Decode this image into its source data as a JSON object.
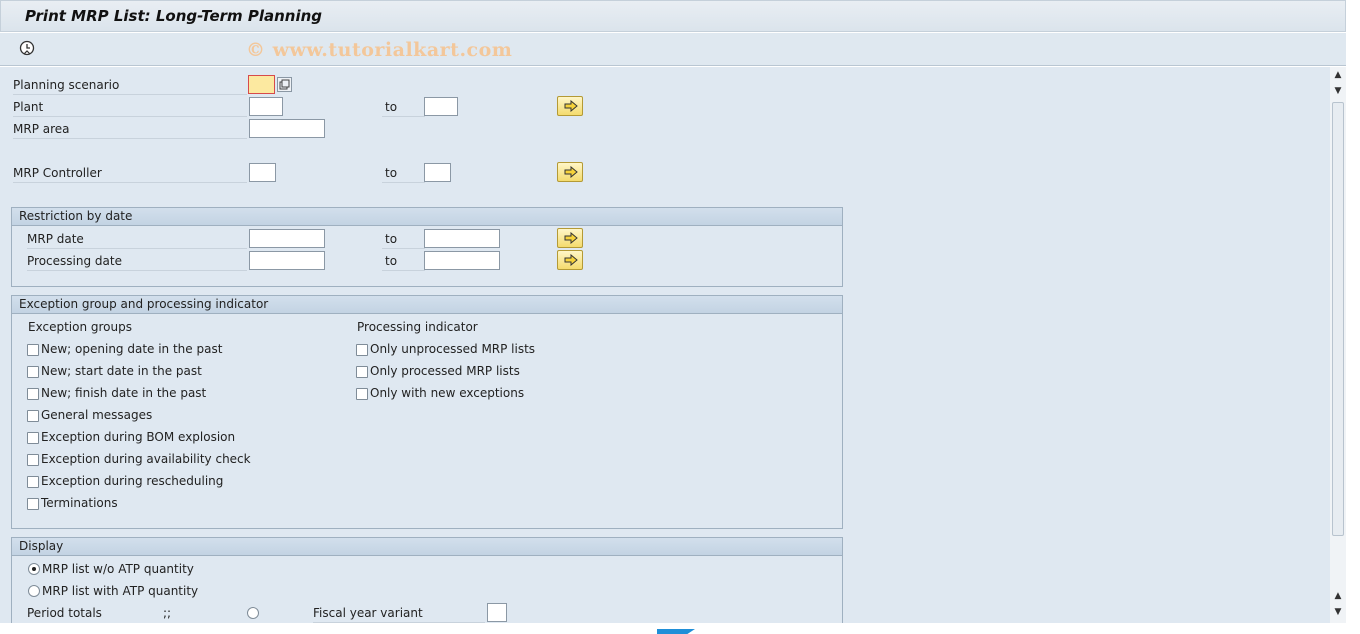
{
  "window": {
    "title": "Print MRP List: Long-Term Planning",
    "watermark": "© www.tutorialkart.com"
  },
  "toolbar": {
    "execute_icon": "clock-execute-icon"
  },
  "selection": {
    "planning_scenario_label": "Planning scenario",
    "plant_label": "Plant",
    "plant_to_label": "to",
    "mrp_area_label": "MRP area",
    "mrp_controller_label": "MRP Controller",
    "mrp_controller_to_label": "to",
    "planning_scenario_value": "",
    "plant_from_value": "",
    "plant_to_value": "",
    "mrp_area_value": "",
    "mrp_controller_from_value": "",
    "mrp_controller_to_value": ""
  },
  "restriction_by_date": {
    "title": "Restriction by date",
    "mrp_date_label": "MRP date",
    "mrp_date_to_label": "to",
    "processing_date_label": "Processing date",
    "processing_date_to_label": "to"
  },
  "exception_group": {
    "title": "Exception group and processing indicator",
    "exception_groups_heading": "Exception groups",
    "exception_groups": [
      {
        "label": "New; opening date in the past",
        "checked": false
      },
      {
        "label": "New; start date in the past",
        "checked": false
      },
      {
        "label": "New; finish date in the past",
        "checked": false
      },
      {
        "label": "General messages",
        "checked": false
      },
      {
        "label": "Exception during BOM explosion",
        "checked": false
      },
      {
        "label": "Exception during availability check",
        "checked": false
      },
      {
        "label": "Exception during rescheduling",
        "checked": false
      },
      {
        "label": "Terminations",
        "checked": false
      }
    ],
    "processing_indicator_heading": "Processing indicator",
    "processing_indicators": [
      {
        "label": "Only unprocessed MRP lists",
        "checked": false
      },
      {
        "label": "Only processed MRP lists",
        "checked": false
      },
      {
        "label": "Only with new exceptions",
        "checked": false
      }
    ]
  },
  "display": {
    "title": "Display",
    "options": [
      {
        "label": "MRP list w/o ATP quantity",
        "selected": true
      },
      {
        "label": "MRP list with ATP quantity",
        "selected": false
      }
    ],
    "period_totals_label": "Period totals",
    "period_totals_marker": ";;",
    "fiscal_year_variant_label": "Fiscal year variant"
  },
  "colors": {
    "background": "#dfe8f1",
    "group_header": "#c3d3e3",
    "required_field": "#fce9a0"
  }
}
